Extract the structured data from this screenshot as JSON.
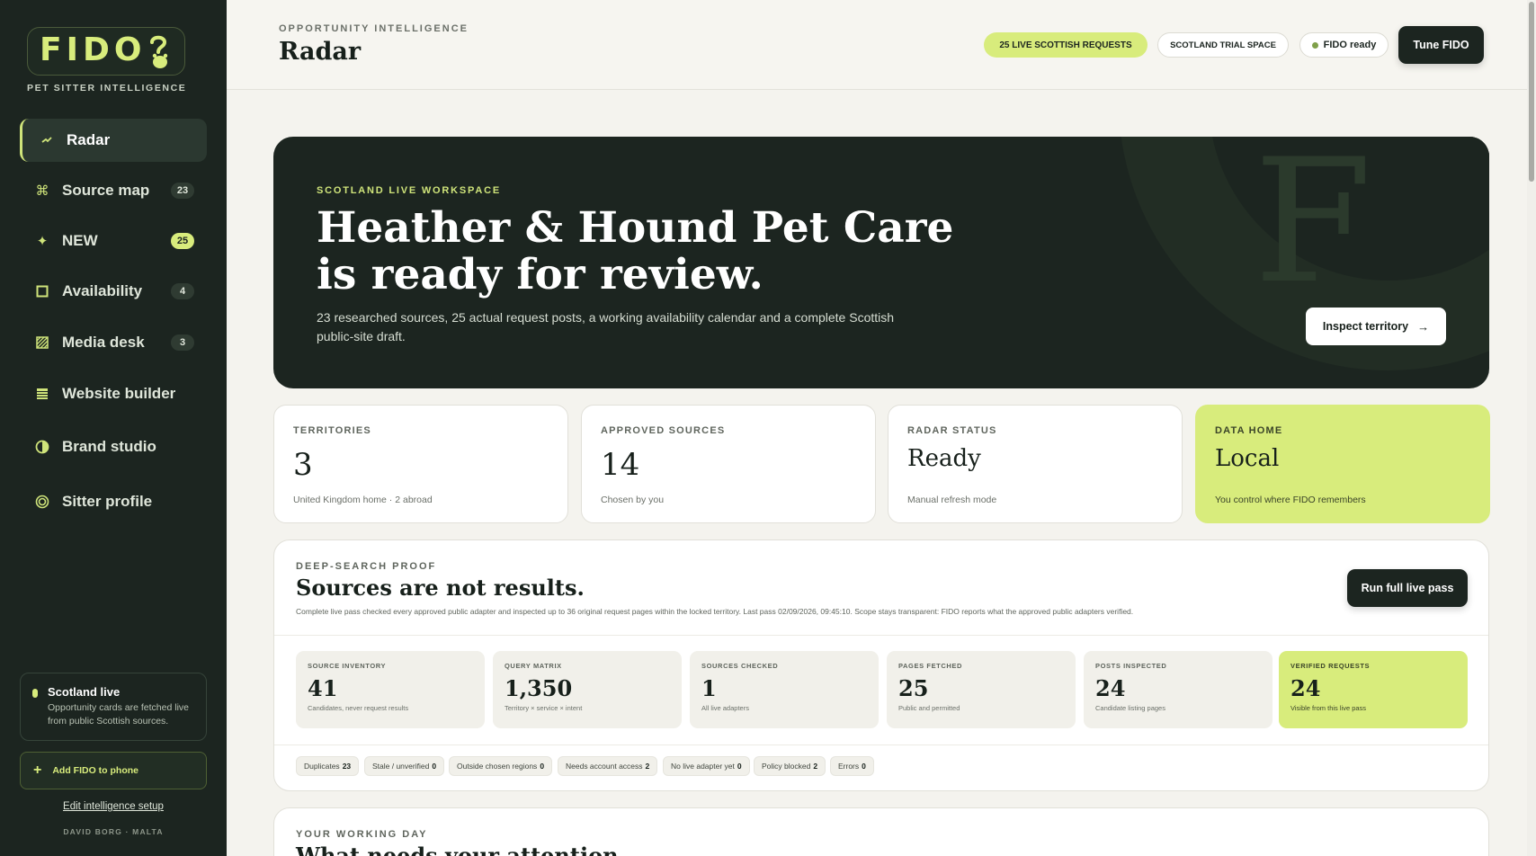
{
  "brand": {
    "logo_text": "FIDO",
    "tagline": "PET SITTER INTELLIGENCE",
    "accent": "#d8ec7c",
    "sidebar_bg": "#1c2520"
  },
  "sidebar": {
    "items": [
      {
        "label": "Radar",
        "icon": "radar-icon",
        "badge": null,
        "active": true
      },
      {
        "label": "Source map",
        "icon": "command-icon",
        "badge": "23",
        "active": false
      },
      {
        "label": "NEW",
        "icon": "sparkle-icon",
        "badge": "25",
        "active": false
      },
      {
        "label": "Availability",
        "icon": "square-icon",
        "badge": "4",
        "active": false
      },
      {
        "label": "Media desk",
        "icon": "hatched-square-icon",
        "badge": "3",
        "active": false
      },
      {
        "label": "Website builder",
        "icon": "layout-icon",
        "badge": null,
        "active": false
      },
      {
        "label": "Brand studio",
        "icon": "contrast-icon",
        "badge": null,
        "active": false
      },
      {
        "label": "Sitter profile",
        "icon": "ring-icon",
        "badge": null,
        "active": false
      }
    ],
    "live_card": {
      "title": "Scotland live",
      "text": "Opportunity cards are fetched live from public Scottish sources."
    },
    "phone_button": "Add FIDO to phone",
    "edit_link": "Edit intelligence setup",
    "footer": "DAVID BORG · MALTA"
  },
  "header": {
    "eyebrow": "OPPORTUNITY INTELLIGENCE",
    "title": "Radar",
    "pill_live": "25 LIVE SCOTTISH REQUESTS",
    "pill_trial": "SCOTLAND TRIAL SPACE",
    "pill_ready": "FIDO ready",
    "tune_button": "Tune FIDO"
  },
  "hero": {
    "eyebrow": "SCOTLAND LIVE WORKSPACE",
    "title": "Heather & Hound Pet Care is ready for review.",
    "description": "23 researched sources, 25 actual request posts, a working availability calendar and a complete Scottish public-site draft.",
    "button": "Inspect territory",
    "watermark": "F"
  },
  "stats": [
    {
      "label": "TERRITORIES",
      "value": "3",
      "note": "United Kingdom home · 2 abroad",
      "highlight": false
    },
    {
      "label": "APPROVED SOURCES",
      "value": "14",
      "note": "Chosen by you",
      "highlight": false
    },
    {
      "label": "RADAR STATUS",
      "value": "Ready",
      "note": "Manual refresh mode",
      "highlight": false
    },
    {
      "label": "DATA HOME",
      "value": "Local",
      "note": "You control where FIDO remembers",
      "highlight": true
    }
  ],
  "proof": {
    "eyebrow": "DEEP-SEARCH PROOF",
    "title": "Sources are not results.",
    "description": "Complete live pass checked every approved public adapter and inspected up to 36 original request pages within the locked territory. Last pass 02/09/2026, 09:45:10. Scope stays transparent: FIDO reports what the approved public adapters verified.",
    "button": "Run full live pass",
    "metrics": [
      {
        "label": "SOURCE INVENTORY",
        "value": "41",
        "note": "Candidates, never request results",
        "highlight": false
      },
      {
        "label": "QUERY MATRIX",
        "value": "1,350",
        "note": "Territory × service × intent",
        "highlight": false
      },
      {
        "label": "SOURCES CHECKED",
        "value": "1",
        "note": "All live adapters",
        "highlight": false
      },
      {
        "label": "PAGES FETCHED",
        "value": "25",
        "note": "Public and permitted",
        "highlight": false
      },
      {
        "label": "POSTS INSPECTED",
        "value": "24",
        "note": "Candidate listing pages",
        "highlight": false
      },
      {
        "label": "VERIFIED REQUESTS",
        "value": "24",
        "note": "Visible from this live pass",
        "highlight": true
      }
    ],
    "chips": [
      {
        "label": "Duplicates",
        "count": "23"
      },
      {
        "label": "Stale / unverified",
        "count": "0"
      },
      {
        "label": "Outside chosen regions",
        "count": "0"
      },
      {
        "label": "Needs account access",
        "count": "2"
      },
      {
        "label": "No live adapter yet",
        "count": "0"
      },
      {
        "label": "Policy blocked",
        "count": "2"
      },
      {
        "label": "Errors",
        "count": "0"
      }
    ]
  },
  "working_day": {
    "eyebrow": "YOUR WORKING DAY",
    "title": "What needs your attention"
  }
}
